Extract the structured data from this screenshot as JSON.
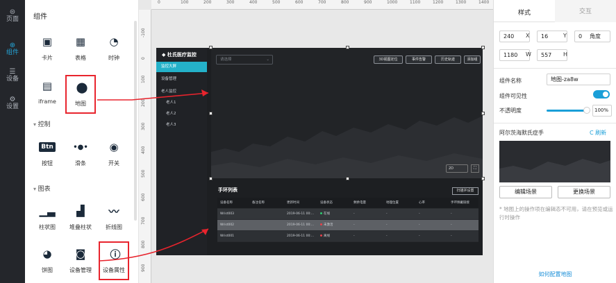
{
  "rail": [
    {
      "icon": "⊜",
      "label": "页面"
    },
    {
      "icon": "⊕",
      "label": "组件",
      "active": true
    },
    {
      "icon": "☰",
      "label": "设备"
    },
    {
      "icon": "⚙",
      "label": "设置"
    }
  ],
  "components": {
    "title": "组件",
    "basic": [
      {
        "icon": "card-icon",
        "glyph": "▣",
        "label": "卡片"
      },
      {
        "icon": "table-icon",
        "glyph": "▦",
        "label": "表格"
      },
      {
        "icon": "clock-icon",
        "glyph": "◔",
        "label": "时钟"
      },
      {
        "icon": "iframe-icon",
        "glyph": "▤",
        "label": "iframe"
      },
      {
        "icon": "map-pin-icon",
        "glyph": "⬤",
        "label": "地图"
      }
    ],
    "controls_section": "控制",
    "controls": [
      {
        "icon": "button-icon",
        "glyph": "Btn",
        "label": "按钮"
      },
      {
        "icon": "slider-icon",
        "glyph": "•●•",
        "label": "滑条"
      },
      {
        "icon": "switch-icon",
        "glyph": "◉",
        "label": "开关"
      }
    ],
    "charts_section": "图表",
    "charts": [
      {
        "icon": "bar-chart-icon",
        "glyph": "▁▃",
        "label": "柱状图"
      },
      {
        "icon": "stacked-bar-icon",
        "glyph": "▟",
        "label": "堆叠柱状"
      },
      {
        "icon": "line-chart-icon",
        "glyph": "〰",
        "label": "折线图"
      },
      {
        "icon": "pie-chart-icon",
        "glyph": "◕",
        "label": "饼图"
      },
      {
        "icon": "device-manage-icon",
        "glyph": "◙",
        "label": "设备管理"
      },
      {
        "icon": "device-props-icon",
        "glyph": "ⓘ",
        "label": "设备属性"
      }
    ]
  },
  "ruler": {
    "top": [
      "0",
      "100",
      "200",
      "300",
      "400",
      "500",
      "600",
      "700",
      "800",
      "900",
      "1000",
      "1100",
      "1200",
      "1300",
      "1400"
    ],
    "left": [
      "-100",
      "0",
      "100",
      "200",
      "300",
      "400",
      "500",
      "600",
      "700",
      "800",
      "900"
    ]
  },
  "dashboard": {
    "logo": "杜氏医疗监控",
    "nav": [
      "监控大屏",
      "设备管理",
      "老人监控",
      "老人1",
      "老人2",
      "老人3"
    ],
    "nav_active": 0,
    "map": {
      "select_placeholder": "请选择",
      "buttons": [
        "3D视图定位",
        "事件告警",
        "历史轨迹",
        "添加组"
      ],
      "layer_toggle": "2D",
      "fullscreen": "⛶"
    },
    "table": {
      "title": "手环列表",
      "button": "扫描并设置",
      "headers": [
        "设备名称",
        "备注名称",
        "更新时间",
        "设备状态",
        "剩余电量",
        "地理位置",
        "心率",
        "手环佩戴链接"
      ],
      "rows": [
        {
          "name": "Wrist003",
          "note": "",
          "time": "2019-06-11 00:...",
          "status": "在线",
          "status_color": "#2ecc71",
          "battery": "-",
          "location": "-",
          "heart": "-",
          "link": "-"
        },
        {
          "name": "Wrist002",
          "note": "",
          "time": "2019-06-11 00:...",
          "status": "未激活",
          "status_color": "#e8404a",
          "battery": "-",
          "location": "-",
          "heart": "-",
          "link": "-"
        },
        {
          "name": "Wrist001",
          "note": "",
          "time": "2019-06-11 00:...",
          "status": "离线",
          "status_color": "#e8404a",
          "battery": "-",
          "location": "-",
          "heart": "-",
          "link": "-"
        }
      ]
    }
  },
  "props": {
    "tab_style": "样式",
    "tab_interact": "交互",
    "x": "240",
    "x_label": "X",
    "y": "16",
    "y_label": "Y",
    "angle": "0",
    "angle_label": "角度",
    "w": "1180",
    "w_label": "W",
    "h": "557",
    "h_label": "H",
    "name_label": "组件名称",
    "name_value": "地图-za8w",
    "visible_label": "组件可见性",
    "visible": true,
    "opacity_label": "不透明度",
    "opacity_value": "100%",
    "scene_title": "阿尔茨海默氏症手",
    "refresh": "C 刷新",
    "edit_scene": "编辑场景",
    "change_scene": "更换场景",
    "note": "* 地图上的操作项在编辑态不可用，请在预览或运行时操作",
    "help_link": "如何配置地图",
    "accent": "#1a9fd8"
  }
}
